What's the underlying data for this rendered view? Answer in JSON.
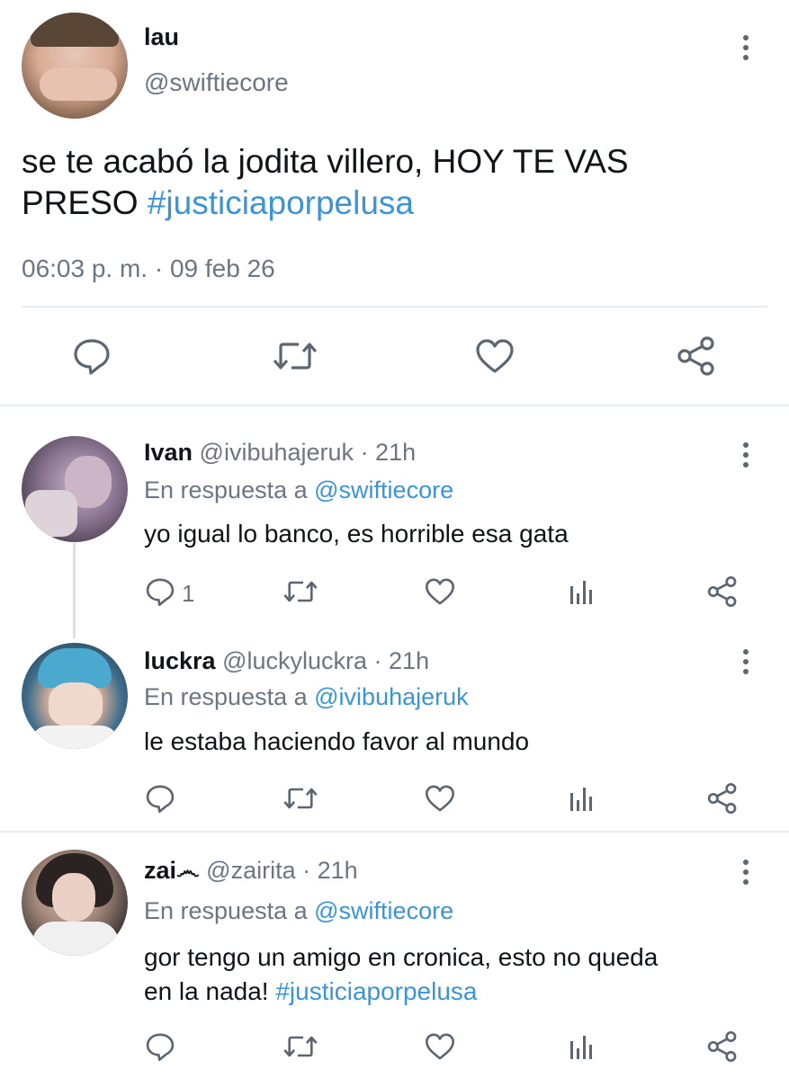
{
  "main_tweet": {
    "display_name": "lau",
    "handle": "@swiftiecore",
    "text": "se te acabó la jodita villero, HOY TE VAS PRESO",
    "text_line1": "se te acabó la jodita villero, HOY TE VAS",
    "text_line2_plain": "PRESO",
    "hashtag": "#justiciaporpelusa",
    "timestamp": "06:03 p. m. · 09 feb 26",
    "actions": [
      "reply-icon",
      "retweet-icon",
      "like-icon",
      "share-icon"
    ]
  },
  "replies": [
    {
      "display_name": "Ivan",
      "handle": "@ivibuhajeruk",
      "time": "· 21h",
      "reply_to_prefix": "En respuesta a",
      "reply_to": "@swiftiecore",
      "text": "yo igual lo banco, es horrible esa gata",
      "reply_count": "1"
    },
    {
      "display_name": "luckra",
      "handle": "@luckyluckra",
      "time": "· 21h",
      "reply_to_prefix": "En respuesta a",
      "reply_to": "@ivibuhajeruk",
      "text": "le estaba haciendo favor al mundo",
      "reply_count": ""
    },
    {
      "display_name": "zai💀",
      "display_name_text": "zai",
      "handle": "@zairita",
      "time": "· 21h",
      "reply_to_prefix": "En respuesta a",
      "reply_to": "@swiftiecore",
      "text_line1": "gor tengo un amigo en cronica, esto no queda",
      "text_line2_plain": "en la nada!",
      "hashtag": "#justiciaporpelusa",
      "reply_count": ""
    }
  ],
  "colors": {
    "link": "#3b94d9",
    "muted": "#6b7682",
    "icon": "#5b6670",
    "divider": "#e6ecf0"
  }
}
